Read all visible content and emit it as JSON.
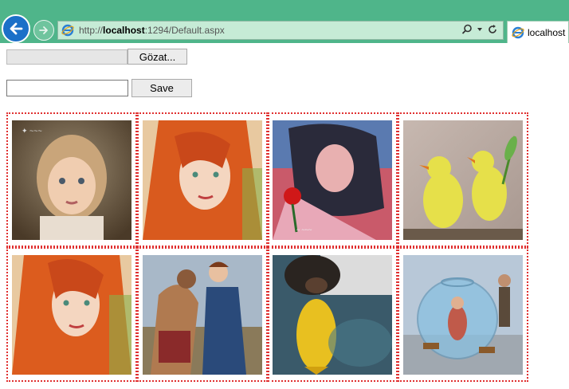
{
  "browser": {
    "url_prefix": "http://",
    "url_host": "localhost",
    "url_rest": ":1294/Default.aspx",
    "tab_title": "localhost",
    "icons": [
      "back-arrow-icon",
      "forward-arrow-icon",
      "ie-logo-icon",
      "search-icon",
      "dropdown-icon",
      "refresh-icon"
    ]
  },
  "form": {
    "file_input_value": "",
    "browse_label": "Gözat...",
    "text_input_value": "",
    "save_label": "Save"
  },
  "gallery": {
    "border_color": "#e03030",
    "columns": 4,
    "rows": [
      [
        "girl-portrait-image",
        "redhead-portrait-image",
        "woman-with-rose-image",
        "yellow-birds-image"
      ],
      [
        "redhead-portrait-2-image",
        "two-women-painting-image",
        "dog-and-fish-image",
        "fishbowl-art-image"
      ]
    ]
  }
}
